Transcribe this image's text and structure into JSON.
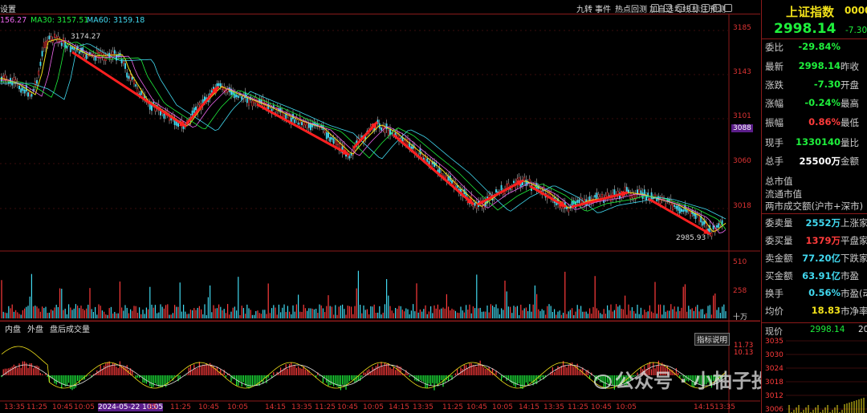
{
  "toolbar": {
    "left_label": "设置",
    "right_buttons": [
      "九转",
      "事件",
      "热点回测",
      "加自选",
      "均线",
      "标注",
      "预测"
    ]
  },
  "ma_legend": {
    "ma5": "156.27",
    "ma30_label": "MA30: 3157.51",
    "ma60_label": "MA60: 3159.18"
  },
  "price_axis": [
    "3185",
    "3143",
    "3101",
    "3088",
    "3060",
    "3018"
  ],
  "annotations": {
    "high": "3174.27",
    "low": "2985.93"
  },
  "volume_axis": [
    "510",
    "258",
    "十万"
  ],
  "indicator_tabs": [
    "内盘",
    "外盘",
    "盘后成交量"
  ],
  "indicator_button": "指标说明",
  "indicator_axis": [
    "11.73",
    "10.13"
  ],
  "time_axis": [
    "13:35",
    "11:25",
    "10:45",
    "10:05",
    "2024-05-22 10:05",
    "35",
    "11:25",
    "10:45",
    "10:05",
    "14:15",
    "13:35",
    "11:25",
    "10:45",
    "10:05",
    "14:15",
    "13:35",
    "11:25",
    "10:45",
    "10:05",
    "14:15",
    "13:35",
    "11:25",
    "10:45",
    "10:05",
    "14:15",
    "13:35"
  ],
  "watermark": "公众号 · 小柚子投资",
  "quote": {
    "name": "上证指数",
    "code": "0000",
    "price": "2998.14",
    "change": "-7.30",
    "rows": [
      {
        "k": "委比",
        "v": "-29.84%",
        "k2": "",
        "c": "green"
      },
      {
        "k": "最新",
        "v": "2998.14",
        "k2": "昨收",
        "c": "green"
      },
      {
        "k": "涨跌",
        "v": "-7.30",
        "k2": "开盘",
        "c": "green"
      },
      {
        "k": "涨幅",
        "v": "-0.24%",
        "k2": "最高",
        "c": "green"
      },
      {
        "k": "振幅",
        "v": "0.86%",
        "k2": "最低",
        "c": "red"
      },
      {
        "k": "现手",
        "v": "1330140",
        "k2": "量比",
        "c": "green"
      },
      {
        "k": "总手",
        "v": "25500万",
        "k2": "金额",
        "c": "white"
      }
    ],
    "rows_plain": [
      "总市值",
      "流通市值",
      "两市成交额(沪市+深市)"
    ],
    "rows2": [
      {
        "k": "委卖量",
        "v": "2552万",
        "k2": "上涨家",
        "c": "cyan"
      },
      {
        "k": "委买量",
        "v": "1379万",
        "k2": "平盘家",
        "c": "red"
      },
      {
        "k": "卖金额",
        "v": "77.20亿",
        "k2": "下跌家",
        "c": "cyan"
      },
      {
        "k": "买金额",
        "v": "63.91亿",
        "k2": "市盈",
        "c": "cyan"
      },
      {
        "k": "换手",
        "v": "0.56%",
        "k2": "市盈(动",
        "c": "cyan"
      },
      {
        "k": "均价",
        "v": "18.83",
        "k2": "市净率",
        "c": "yel"
      }
    ],
    "mini": {
      "label": "现价",
      "value": "2998.14",
      "extra": "20",
      "axis": [
        "3035",
        "3030",
        "3024",
        "3018",
        "3012",
        "3006"
      ]
    }
  },
  "colors": {
    "up": "#ff3b3b",
    "down": "#1ef03c",
    "grid": "#8b1a1a"
  }
}
